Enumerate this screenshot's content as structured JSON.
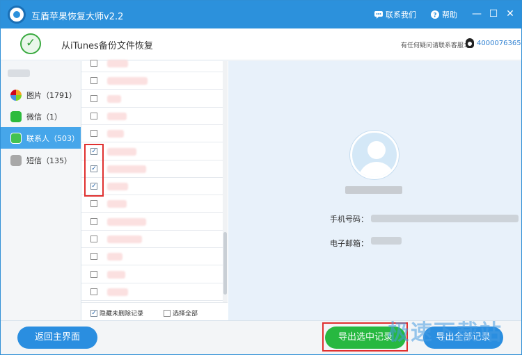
{
  "app": {
    "title": "互盾苹果恢复大师v2.2",
    "contact_label": "联系我们",
    "help_label": "帮助",
    "minimize": "—",
    "maximize": "☐",
    "close": "✕"
  },
  "header": {
    "title": "从iTunes备份文件恢复",
    "support_text": "有任何疑问请联系客服：",
    "qq_number": "4000076365"
  },
  "sidebar": {
    "items": [
      {
        "label": "图片（1791）",
        "icon": "photos-icon"
      },
      {
        "label": "微信（1）",
        "icon": "wechat-icon"
      },
      {
        "label": "联系人（503）",
        "icon": "contacts-icon",
        "active": true
      },
      {
        "label": "短信（135）",
        "icon": "sms-icon"
      }
    ]
  },
  "list": {
    "rows": [
      {
        "checked": false
      },
      {
        "checked": false
      },
      {
        "checked": false
      },
      {
        "checked": false
      },
      {
        "checked": false
      },
      {
        "checked": true
      },
      {
        "checked": true
      },
      {
        "checked": true
      },
      {
        "checked": false
      },
      {
        "checked": false
      },
      {
        "checked": false
      },
      {
        "checked": false
      },
      {
        "checked": false
      },
      {
        "checked": false
      },
      {
        "checked": false
      }
    ],
    "hide_deleted_label": "隐藏未删除记录",
    "select_all_label": "选择全部"
  },
  "details": {
    "phone_label": "手机号码：",
    "email_label": "电子邮箱："
  },
  "footer": {
    "home_button": "返回主界面",
    "export_selected_button": "导出选中记录",
    "export_all_button": "导出全部记录",
    "watermark": "极速下载站"
  },
  "colors": {
    "titlebar": "#2c91dc",
    "active_item": "#46a6ea",
    "export_selected": "#27b840",
    "highlight": "#e0302f"
  }
}
